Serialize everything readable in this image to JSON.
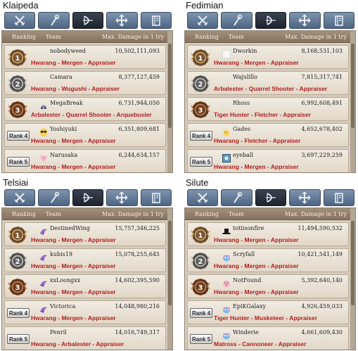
{
  "header": {
    "ranking": "Ranking",
    "team": "Team",
    "max_damage": "Max. Damage in 1 try"
  },
  "colors": {
    "team_text": "#b01e1e",
    "board_bg": "#d6cbbb",
    "header_bg": "#8d7a66",
    "tab_active": "#2a313c",
    "tab_inactive": "#6a809c"
  },
  "tabs": [
    {
      "icon": "crossed-swords-icon",
      "active": false
    },
    {
      "icon": "staff-icon",
      "active": false
    },
    {
      "icon": "bow-icon",
      "active": true
    },
    {
      "icon": "compass-arrows-icon",
      "active": false
    },
    {
      "icon": "tome-icon",
      "active": false
    }
  ],
  "servers": [
    {
      "name": "Klaipeda",
      "rows": [
        {
          "rank": "1",
          "avatar": "none",
          "name": "nobodyweed",
          "damage": "10,502,111,093",
          "team": "Hwarang - Mergen - Appraiser"
        },
        {
          "rank": "2",
          "avatar": "none",
          "name": "Camara",
          "damage": "8,377,127,459",
          "team": "Hwarang - Wugushi - Appraiser"
        },
        {
          "rank": "3",
          "avatar": "helmet",
          "name": "MegaBreak",
          "damage": "6,731,944,050",
          "team": "Arbalester - Quarrel Shooter - Arquebusier"
        },
        {
          "rank": "Rank 4",
          "avatar": "sunglasses",
          "name": "Yoshiyuki",
          "damage": "6,351,809,681",
          "team": "Hwarang - Mergen - Appraiser"
        },
        {
          "rank": "Rank 5",
          "avatar": "flower",
          "name": "Narusaka",
          "damage": "6,244,634,157",
          "team": "Hwarang - Mergen - Appraiser"
        }
      ]
    },
    {
      "name": "Fedimian",
      "rows": [
        {
          "rank": "1",
          "avatar": "moon",
          "name": "Dworkin",
          "damage": "8,168,531,103",
          "team": "Hwarang - Mergen - Appraiser"
        },
        {
          "rank": "2",
          "avatar": "none",
          "name": "Wajulillo",
          "damage": "7,815,317,741",
          "team": "Arbalester - Quarrel Shooter - Appraiser"
        },
        {
          "rank": "3",
          "avatar": "none",
          "name": "Rhoss",
          "damage": "6,992,608,491",
          "team": "Tiger Hunter - Fletcher - Appraiser"
        },
        {
          "rank": "Rank 4",
          "avatar": "chick",
          "name": "Gades",
          "damage": "4,652,678,402",
          "team": "Hwarang - Fletcher - Appraiser"
        },
        {
          "rank": "Rank 5",
          "avatar": "frame",
          "name": "eyeball",
          "damage": "3,697,229,259",
          "team": "Hwarang - Mergen - Appraiser"
        }
      ]
    },
    {
      "name": "Telsiai",
      "rows": [
        {
          "rank": "1",
          "avatar": "bird",
          "name": "DestinedWing",
          "damage": "15,757,346,225",
          "team": "Hwarang - Mergen - Appraiser"
        },
        {
          "rank": "2",
          "avatar": "bird",
          "name": "kubis19",
          "damage": "15,078,255,645",
          "team": "Hwarang - Mergen - Appraiser"
        },
        {
          "rank": "3",
          "avatar": "bird",
          "name": "xxLoongxx",
          "damage": "14,602,395,590",
          "team": "Hwarang - Mergen - Appraiser"
        },
        {
          "rank": "Rank 4",
          "avatar": "bird",
          "name": "Victorica",
          "damage": "14,048,980,216",
          "team": "Hwarang - Mergen - Appraiser"
        },
        {
          "rank": "Rank 5",
          "avatar": "none",
          "name": "Penril",
          "damage": "14,016,749,317",
          "team": "Hwarang - Arbalester - Appraiser"
        }
      ]
    },
    {
      "name": "Silute",
      "rows": [
        {
          "rank": "1",
          "avatar": "hat",
          "name": "totiisonfire",
          "damage": "11,494,590,532",
          "team": "Hwarang - Mergen - Appraiser"
        },
        {
          "rank": "2",
          "avatar": "creature",
          "name": "Scryfall",
          "damage": "10,421,541,149",
          "team": "Hwarang - Mergen - Appraiser"
        },
        {
          "rank": "3",
          "avatar": "pig",
          "name": "NotFound",
          "damage": "5,392,640,140",
          "team": "Hwarang - Mergen - Appraiser"
        },
        {
          "rank": "Rank 4",
          "avatar": "creature",
          "name": "EpiKGalaxy",
          "damage": "4,926,459,033",
          "team": "Tiger Hunter - Musketeer - Appraiser"
        },
        {
          "rank": "Rank 5",
          "avatar": "creature",
          "name": "Winderie",
          "damage": "4,661,609,430",
          "team": "Matross - Cannoneer - Appraiser"
        }
      ]
    }
  ]
}
